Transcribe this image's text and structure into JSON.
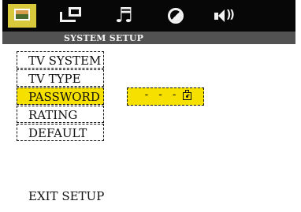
{
  "top_menu": {
    "tabs": [
      {
        "icon": "setup-screen-icon",
        "selected": true
      },
      {
        "icon": "tv-display-icon",
        "selected": false
      },
      {
        "icon": "audio-note-icon",
        "glyph": "♬",
        "selected": false
      },
      {
        "icon": "preferences-icon",
        "selected": false
      },
      {
        "icon": "speaker-icon",
        "glyph": "))",
        "selected": false
      }
    ]
  },
  "header": {
    "title": "SYSTEM SETUP"
  },
  "menu": {
    "items": [
      {
        "label": "TV SYSTEM",
        "selected": false
      },
      {
        "label": "TV TYPE",
        "selected": false
      },
      {
        "label": "PASSWORD",
        "selected": true
      },
      {
        "label": "RATING",
        "selected": false
      },
      {
        "label": "DEFAULT",
        "selected": false
      }
    ]
  },
  "password_field": {
    "value": "- - - -",
    "icon": "lock-icon"
  },
  "footer": {
    "exit_label": "EXIT SETUP"
  },
  "colors": {
    "background": "#ffffff",
    "top_bar": "#070707",
    "sub_bar": "#525252",
    "highlight": "#f6e000",
    "selected_tab": "#d8c93c"
  }
}
